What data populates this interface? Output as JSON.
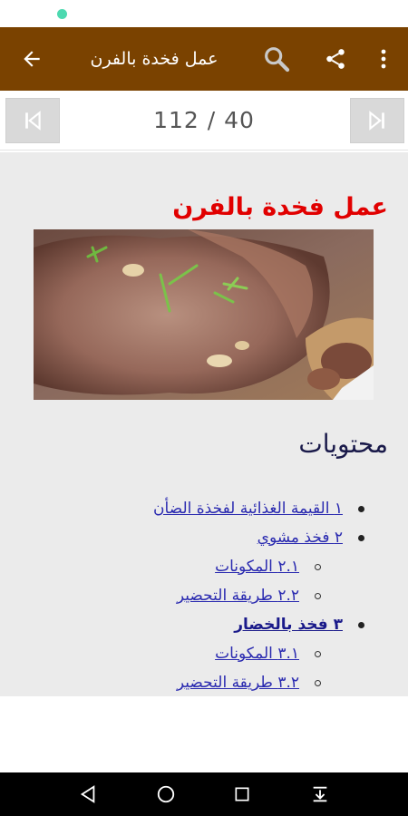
{
  "app_bar": {
    "title": "عمل فخدة بالفرن",
    "back_icon": "arrow-left-icon",
    "search_icon": "search-icon",
    "share_icon": "share-icon",
    "more_icon": "more-vertical-icon",
    "color": "#7a4200"
  },
  "pager": {
    "counter": "112 / 40",
    "first_icon": "skip-first-icon",
    "last_icon": "skip-last-icon"
  },
  "article": {
    "title": "عمل فخدة بالفرن",
    "image_alt": "roast-lamb-leg-image",
    "toc_heading": "محتويات",
    "toc": [
      {
        "label": "١ القيمة الغذائية لفخذة الضأن",
        "level": 1
      },
      {
        "label": "٢ فخذ مشوي",
        "level": 1
      },
      {
        "label": "٢.١ المكونات",
        "level": 2
      },
      {
        "label": "٢.٢ طريقة التحضير",
        "level": 2
      },
      {
        "label": "٣ فخذ بالخضار",
        "level": 1
      },
      {
        "label": "٣.١ المكونات",
        "level": 2
      },
      {
        "label": "٣.٢ طريقة التحضير",
        "level": 2
      }
    ]
  },
  "system_nav": {
    "back_icon": "triangle-back-icon",
    "home_icon": "circle-home-icon",
    "recents_icon": "square-recents-icon",
    "notifications_icon": "pull-down-icon"
  }
}
